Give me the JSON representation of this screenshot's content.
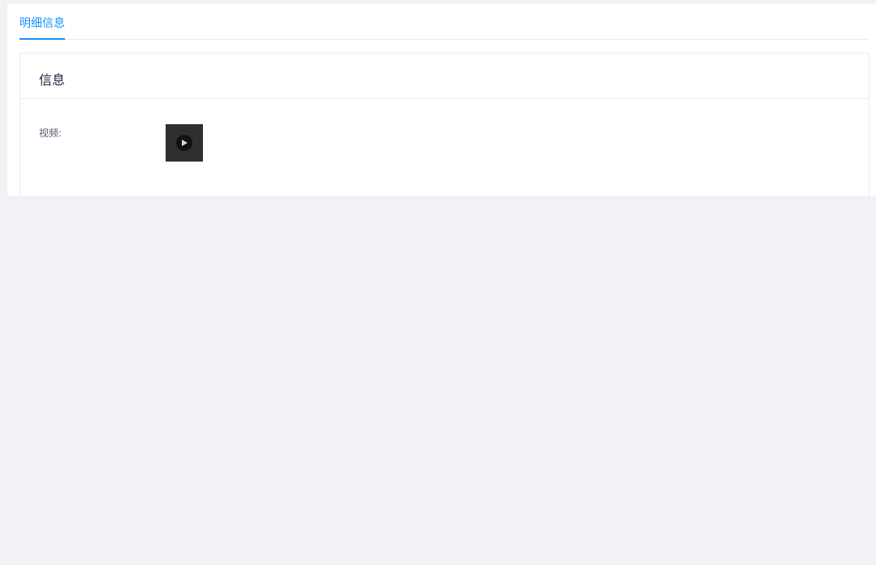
{
  "tabs": [
    {
      "label": "明细信息",
      "active": true
    }
  ],
  "card": {
    "title": "信息",
    "fields": [
      {
        "label": "视频:",
        "value_type": "video",
        "icon": "play-icon"
      }
    ]
  },
  "colors": {
    "accent": "#1890ff",
    "background": "#f0f2f5",
    "border": "#e8eaec",
    "thumbnail": "#2f2f2f"
  }
}
